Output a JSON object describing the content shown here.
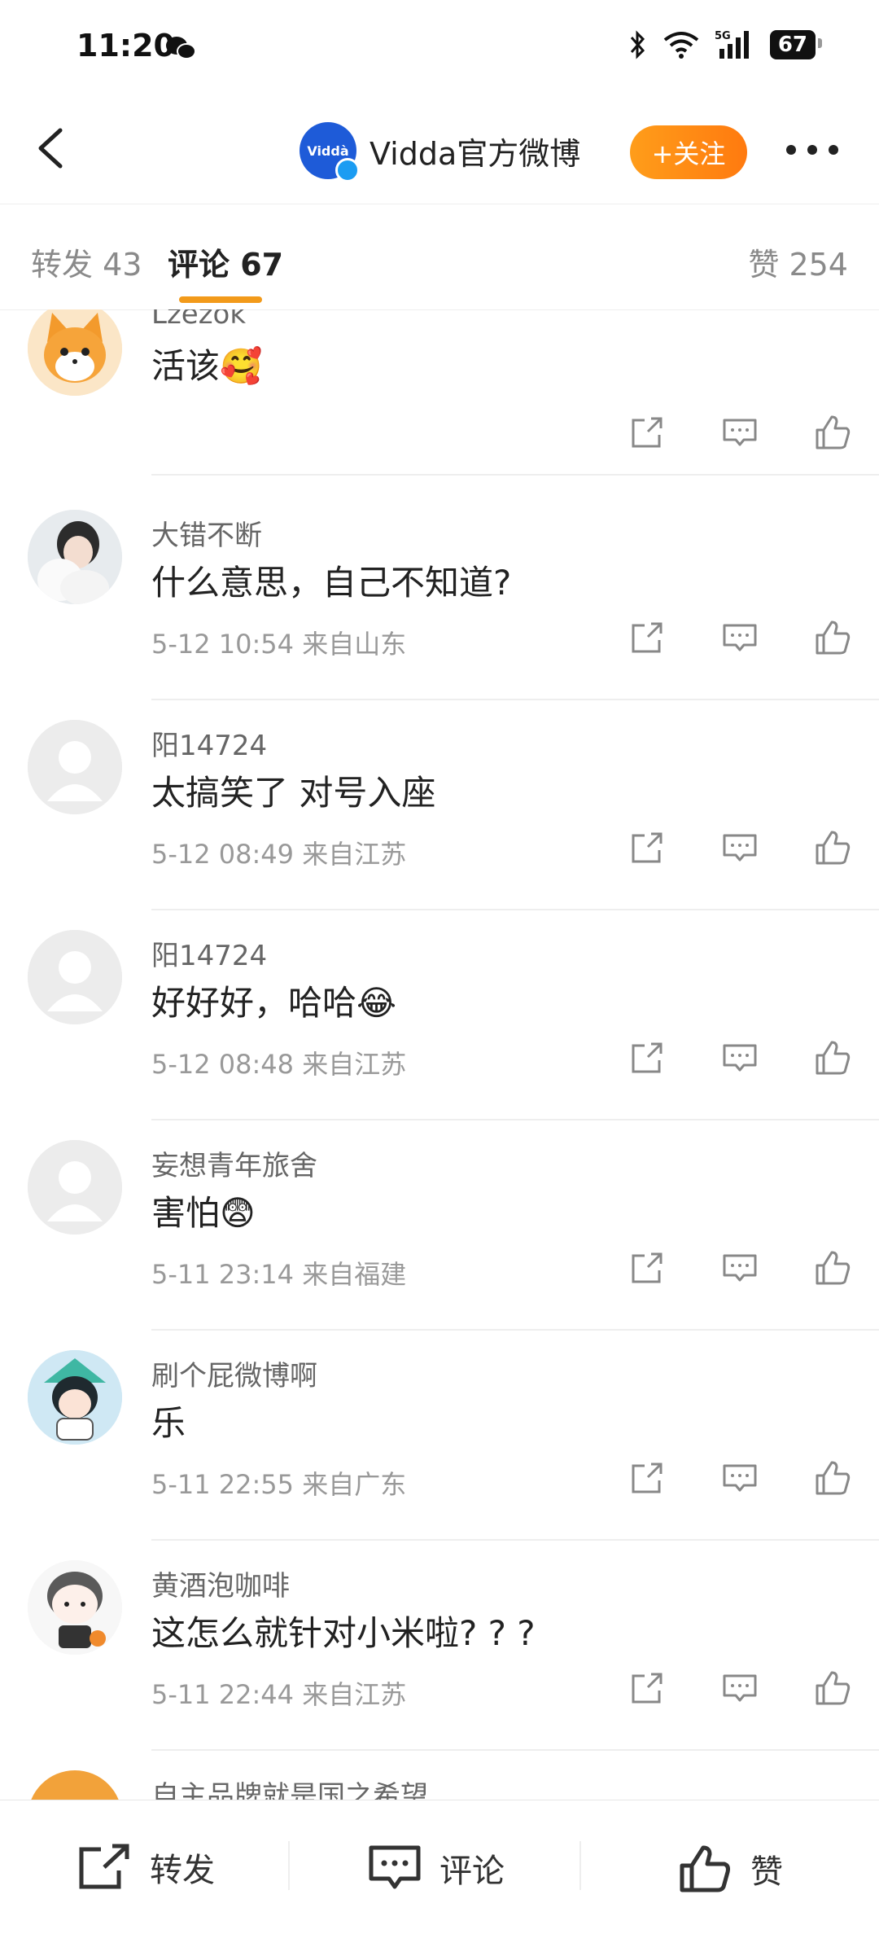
{
  "status": {
    "time": "11:20",
    "battery": "67"
  },
  "header": {
    "brand_logo_text": "Viddà",
    "account_name": "Vidda官方微博",
    "follow_label": "+关注"
  },
  "tabs": [
    {
      "label": "转发 43"
    },
    {
      "label": "评论 67"
    },
    {
      "label": "赞 254"
    }
  ],
  "comments": [
    {
      "name": "Lzezok",
      "text": "活该",
      "emoji": "🥰",
      "meta": ""
    },
    {
      "name": "大错不断",
      "text": "什么意思，自己不知道?",
      "emoji": "",
      "meta": "5-12 10:54  来自山东"
    },
    {
      "name": "阳14724",
      "text": "太搞笑了 对号入座",
      "emoji": "",
      "meta": "5-12 08:49  来自江苏"
    },
    {
      "name": "阳14724",
      "text": "好好好，哈哈",
      "emoji": "😂",
      "meta": "5-12 08:48  来自江苏"
    },
    {
      "name": "妄想青年旅舍",
      "text": "害怕",
      "emoji": "😨",
      "meta": "5-11 23:14  来自福建"
    },
    {
      "name": "刷个屁微博啊",
      "text": "乐",
      "emoji": "",
      "meta": "5-11 22:55  来自广东"
    },
    {
      "name": "黄酒泡咖啡",
      "text": "这怎么就针对小米啦? ? ?",
      "emoji": "",
      "meta": "5-11 22:44  来自江苏"
    }
  ],
  "partial_comment_name": "自主品牌就是国之希望",
  "bottom": {
    "repost": "转发",
    "comment": "评论",
    "like": "赞"
  },
  "colors": {
    "accent": "#f29a1a",
    "follow_start": "#ff9d1a",
    "follow_end": "#ff7a0f"
  }
}
